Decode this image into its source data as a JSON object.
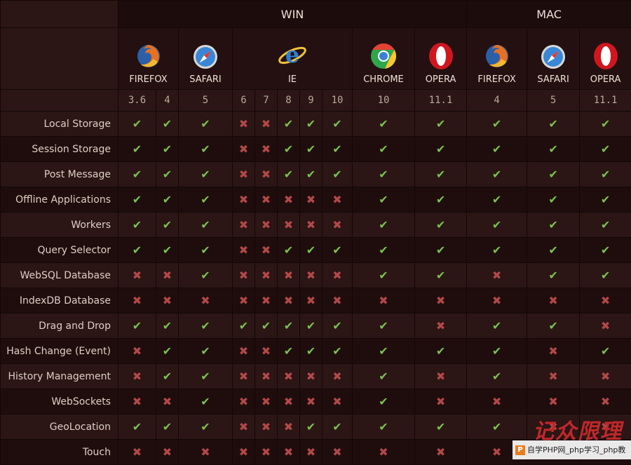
{
  "os_headers": {
    "win": "WIN",
    "mac": "MAC"
  },
  "browsers": {
    "win_firefox": {
      "label": "FIREFOX",
      "icon": "firefox-icon"
    },
    "win_safari": {
      "label": "SAFARI",
      "icon": "safari-icon"
    },
    "win_ie": {
      "label": "IE",
      "icon": "internet-explorer-icon"
    },
    "win_chrome": {
      "label": "CHROME",
      "icon": "chrome-icon"
    },
    "win_opera": {
      "label": "OPERA",
      "icon": "opera-icon"
    },
    "mac_firefox": {
      "label": "FIREFOX",
      "icon": "firefox-icon"
    },
    "mac_safari": {
      "label": "SAFARI",
      "icon": "safari-icon"
    },
    "mac_opera": {
      "label": "OPERA",
      "icon": "opera-icon"
    }
  },
  "versions": [
    "3.6",
    "4",
    "5",
    "6",
    "7",
    "8",
    "9",
    "10",
    "10",
    "11.1",
    "4",
    "5",
    "11.1"
  ],
  "symbols": {
    "yes": "✔",
    "no": "✖"
  },
  "colors": {
    "yes": "#79c24f",
    "no": "#b34848"
  },
  "features": [
    {
      "name": "Local Storage",
      "support": [
        1,
        1,
        1,
        0,
        0,
        1,
        1,
        1,
        1,
        1,
        1,
        1,
        1
      ]
    },
    {
      "name": "Session Storage",
      "support": [
        1,
        1,
        1,
        0,
        0,
        1,
        1,
        1,
        1,
        1,
        1,
        1,
        1
      ]
    },
    {
      "name": "Post Message",
      "support": [
        1,
        1,
        1,
        0,
        0,
        1,
        1,
        1,
        1,
        1,
        1,
        1,
        1
      ]
    },
    {
      "name": "Offline Applications",
      "support": [
        1,
        1,
        1,
        0,
        0,
        0,
        0,
        0,
        1,
        1,
        1,
        1,
        1
      ]
    },
    {
      "name": "Workers",
      "support": [
        1,
        1,
        1,
        0,
        0,
        0,
        0,
        0,
        1,
        1,
        1,
        1,
        1
      ]
    },
    {
      "name": "Query Selector",
      "support": [
        1,
        1,
        1,
        0,
        0,
        1,
        1,
        1,
        1,
        1,
        1,
        1,
        1
      ]
    },
    {
      "name": "WebSQL Database",
      "support": [
        0,
        0,
        1,
        0,
        0,
        0,
        0,
        0,
        1,
        1,
        0,
        1,
        1
      ]
    },
    {
      "name": "IndexDB Database",
      "support": [
        0,
        0,
        0,
        0,
        0,
        0,
        0,
        0,
        0,
        0,
        0,
        0,
        0
      ]
    },
    {
      "name": "Drag and Drop",
      "support": [
        1,
        1,
        1,
        1,
        1,
        1,
        1,
        1,
        1,
        0,
        1,
        1,
        0
      ]
    },
    {
      "name": "Hash Change (Event)",
      "support": [
        0,
        1,
        1,
        0,
        0,
        1,
        1,
        1,
        1,
        1,
        1,
        0,
        1
      ]
    },
    {
      "name": "History Management",
      "support": [
        0,
        1,
        1,
        0,
        0,
        0,
        0,
        0,
        1,
        0,
        1,
        0,
        0
      ]
    },
    {
      "name": "WebSockets",
      "support": [
        0,
        0,
        1,
        0,
        0,
        0,
        0,
        0,
        1,
        0,
        0,
        0,
        0
      ]
    },
    {
      "name": "GeoLocation",
      "support": [
        1,
        1,
        1,
        0,
        0,
        0,
        1,
        1,
        1,
        1,
        1,
        0,
        0
      ]
    },
    {
      "name": "Touch",
      "support": [
        0,
        0,
        0,
        0,
        0,
        0,
        0,
        0,
        0,
        0,
        0,
        0,
        0
      ]
    }
  ],
  "watermark": {
    "text": "自学PHP网_php学习_php教",
    "logo": "P",
    "script": "记众限理"
  }
}
